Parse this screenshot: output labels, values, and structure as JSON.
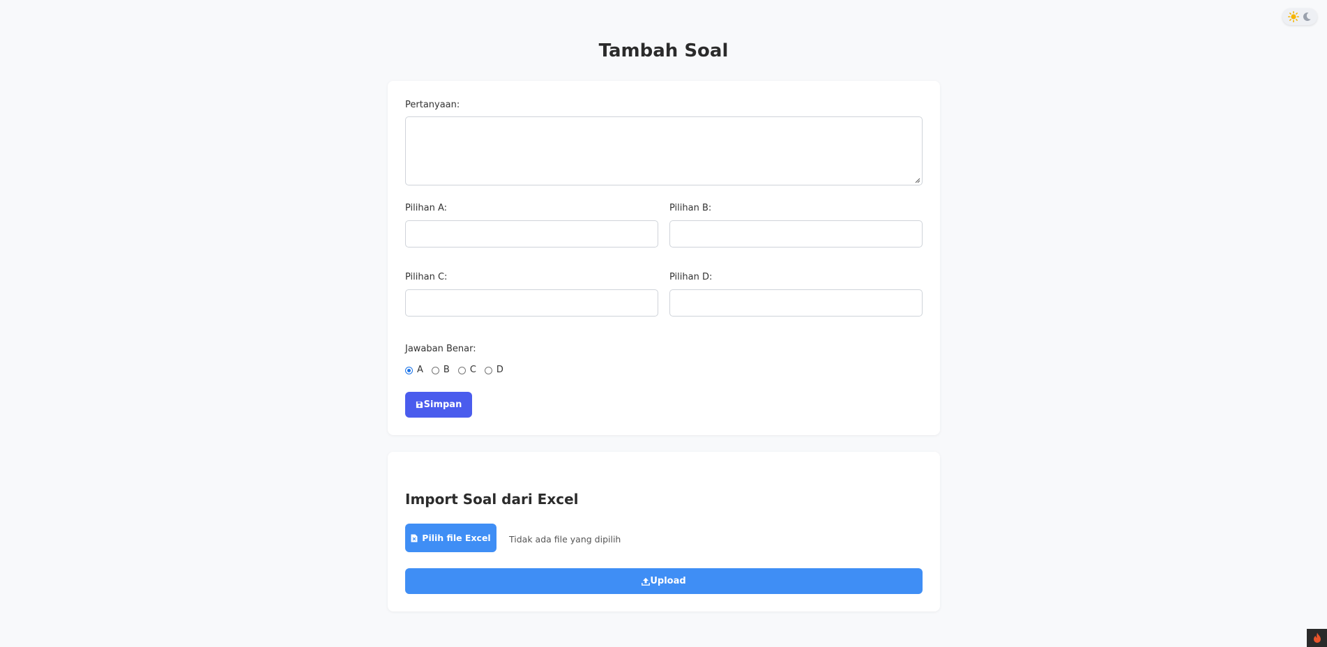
{
  "page": {
    "title": "Tambah Soal"
  },
  "theme_toggle": {
    "light_icon": "sun-icon",
    "dark_icon": "moon-icon"
  },
  "form": {
    "question_label": "Pertanyaan:",
    "question_value": "",
    "option_a_label": "Pilihan A:",
    "option_b_label": "Pilihan B:",
    "option_c_label": "Pilihan C:",
    "option_d_label": "Pilihan D:",
    "answer_label": "Jawaban Benar:",
    "answers": [
      "A",
      "B",
      "C",
      "D"
    ],
    "selected_answer": "A",
    "save_label": "Simpan",
    "save_icon": "save-icon"
  },
  "import": {
    "title": "Import Soal dari Excel",
    "choose_file_label": "Pilih file Excel",
    "choose_file_icon": "file-excel-icon",
    "no_file_text": "Tidak ada file yang dipilih",
    "upload_label": "Upload",
    "upload_icon": "upload-icon"
  },
  "colors": {
    "save_button": "#4a5ced",
    "primary_button": "#3f8ef5",
    "background": "#f8f9fb"
  }
}
